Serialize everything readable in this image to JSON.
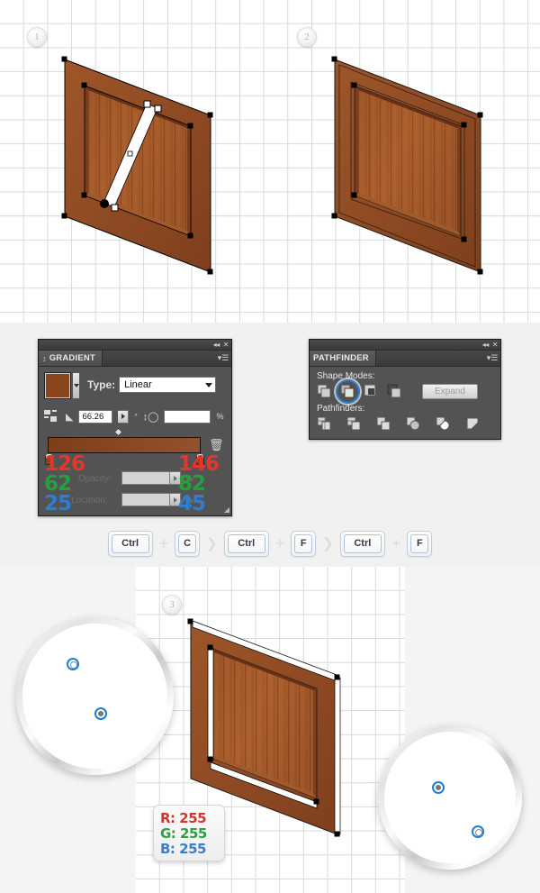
{
  "steps": [
    {
      "number": "1"
    },
    {
      "number": "2"
    },
    {
      "number": "3"
    }
  ],
  "gradient_panel": {
    "title": "GRADIENT",
    "grip_icon": "grip-icon",
    "collapse_icon": "collapse-icon",
    "close_icon": "close-icon",
    "menu_icon": "panel-menu-icon",
    "swatch_color": "#8a451f",
    "type_label": "Type:",
    "type_value": "Linear",
    "reverse_icon": "reverse-gradient-icon",
    "angle_icon": "angle-icon",
    "angle_value": "66.26",
    "degree_symbol": "°",
    "aspect_icon": "aspect-ratio-icon",
    "aspect_value": "",
    "percent_symbol": "%",
    "opacity_label": "Opacity:",
    "opacity_value": "",
    "location_label": "Location:",
    "location_value": "",
    "trash_icon": "delete-stop-icon",
    "ramp_start_color": "#7e3e19",
    "ramp_end_color": "#92522d",
    "left_stop": {
      "r": "126",
      "g": "62",
      "b": "25"
    },
    "right_stop": {
      "r": "146",
      "g": "82",
      "b": "45"
    },
    "color_r_hex": "#e8342a",
    "color_g_hex": "#24a03c",
    "color_b_hex": "#2a7fd4"
  },
  "pathfinder_panel": {
    "title": "PATHFINDER",
    "collapse_icon": "collapse-icon",
    "close_icon": "close-icon",
    "menu_icon": "panel-menu-icon",
    "shape_modes_label": "Shape Modes:",
    "pathfinders_label": "Pathfinders:",
    "expand_label": "Expand",
    "shape_modes": [
      {
        "name": "unite-icon",
        "selected": false
      },
      {
        "name": "minus-front-icon",
        "selected": true
      },
      {
        "name": "intersect-icon",
        "selected": false
      },
      {
        "name": "exclude-icon",
        "selected": false
      }
    ],
    "pathfinders": [
      {
        "name": "divide-icon"
      },
      {
        "name": "trim-icon"
      },
      {
        "name": "merge-icon"
      },
      {
        "name": "crop-icon"
      },
      {
        "name": "outline-icon"
      },
      {
        "name": "minus-back-icon"
      }
    ],
    "highlight_color": "#2f7fd1"
  },
  "key_sequence": [
    {
      "type": "key",
      "label": "Ctrl",
      "size": "wide"
    },
    {
      "type": "plus",
      "label": "+"
    },
    {
      "type": "key",
      "label": "C",
      "size": "narrow"
    },
    {
      "type": "arrow",
      "label": "❯"
    },
    {
      "type": "key",
      "label": "Ctrl",
      "size": "wide"
    },
    {
      "type": "plus",
      "label": "+"
    },
    {
      "type": "key",
      "label": "F",
      "size": "narrow"
    },
    {
      "type": "arrow",
      "label": "❯"
    },
    {
      "type": "key",
      "label": "Ctrl",
      "size": "wide"
    },
    {
      "type": "plus",
      "label": "+"
    },
    {
      "type": "key",
      "label": "F",
      "size": "narrow"
    }
  ],
  "rgb_card": {
    "r_label": "R: 255",
    "g_label": "G: 255",
    "b_label": "B: 255",
    "r_color": "#d5332b",
    "g_color": "#2ba03f",
    "b_color": "#3a7fc9"
  },
  "artwork": {
    "description": "Isometric wooden door panel illustration with vector anchor points",
    "wood_frame_color": "#9b5429",
    "wood_frame_dark": "#7e3f1c",
    "wood_plank_light": "#b1642f",
    "wood_plank_dark": "#8c4a22",
    "anchor_color": "#000000",
    "highlight_stroke": "#ffffff"
  }
}
